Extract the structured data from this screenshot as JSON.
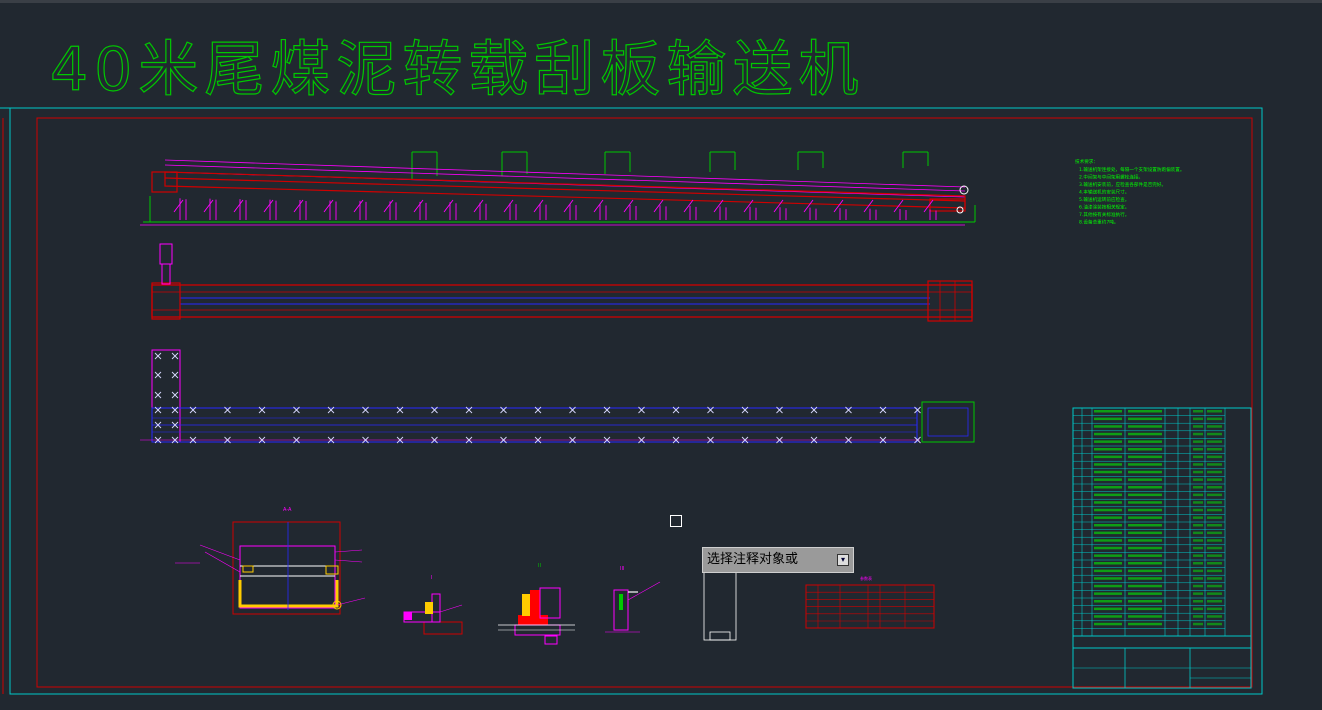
{
  "drawing": {
    "title": "40米尾煤泥转载刮板输送机",
    "tech_notes_heading": "技术要求：",
    "tech_notes": [
      "1.输送机架连接处，每隔一个支架设置防跑偏装置。",
      "2.中间架与中间架用螺栓连接。",
      "3.输送机安装前，应检查各部件是否完好。",
      "4.本输送机的安装尺寸。",
      "5.输送机运转前应检查。",
      "6.油漆涂装按相关规定。",
      "7.其他按有关标准执行。",
      "8.设备总重约7吨。"
    ],
    "detail_label": "A-A",
    "section_label_1": "I",
    "section_label_2": "II",
    "section_label_3": "III"
  },
  "tooltip": {
    "text": "选择注释对象或"
  },
  "colors": {
    "background": "#212830",
    "title_green": "#00c800",
    "frame_cyan": "#00c8c8",
    "frame_red": "#d00000",
    "magenta": "#ff00ff",
    "blue": "#2828ff"
  }
}
